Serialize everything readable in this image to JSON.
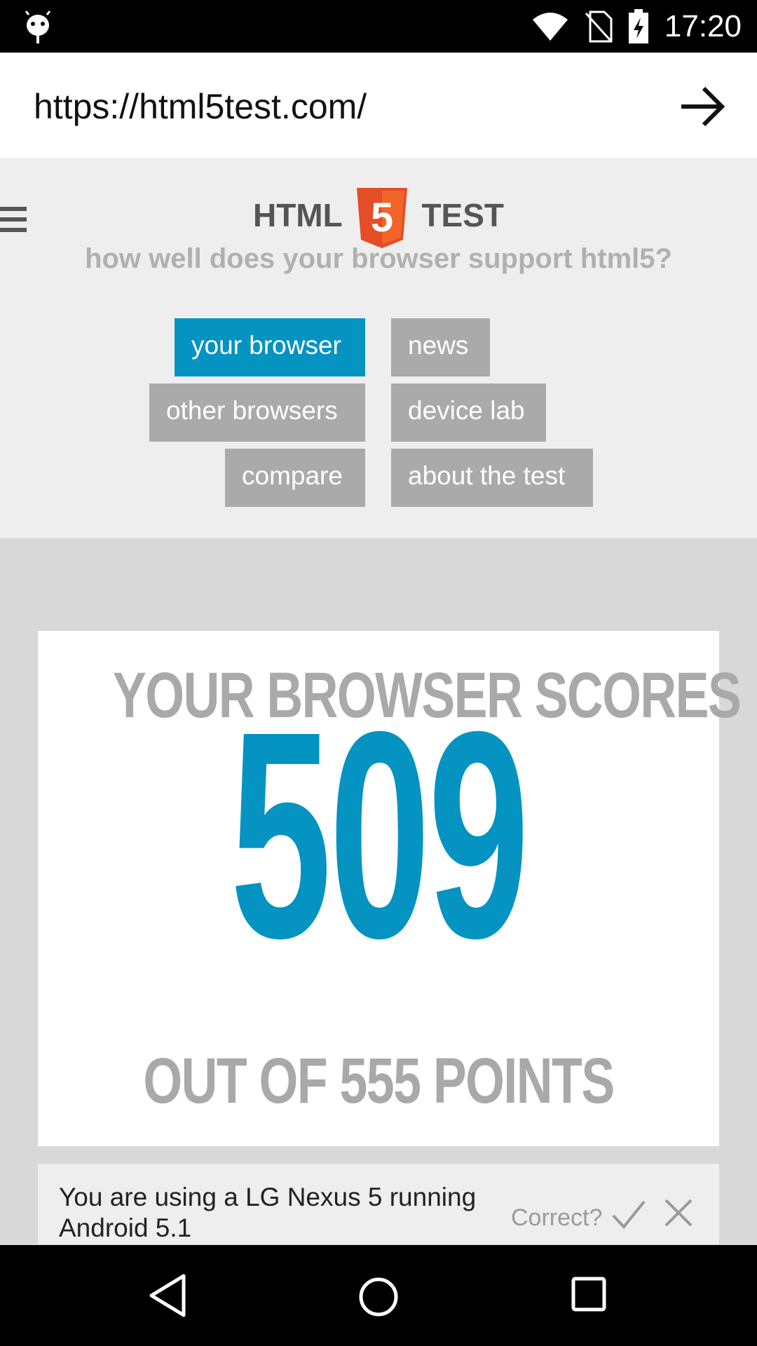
{
  "status_bar": {
    "time": "17:20",
    "icons": [
      "android-icon",
      "wifi-icon",
      "no-sim-icon",
      "battery-charging-icon"
    ]
  },
  "url_bar": {
    "value": "https://html5test.com/",
    "go_icon": "arrow-right-icon"
  },
  "header": {
    "menu_icon": "hamburger-menu-icon",
    "logo_left": "HTML",
    "logo_badge": "5",
    "logo_right": "TEST",
    "tagline": "how well does your browser support html5?",
    "brand_color": "#e44d26",
    "nav": [
      {
        "label": "your browser",
        "active": true
      },
      {
        "label": "news",
        "active": false
      },
      {
        "label": "other browsers",
        "active": false
      },
      {
        "label": "device lab",
        "active": false
      },
      {
        "label": "compare",
        "active": false
      },
      {
        "label": "about the test",
        "active": false
      }
    ],
    "active_color": "#0593c2",
    "inactive_color": "#aaaaaa"
  },
  "score": {
    "heading": "YOUR BROWSER SCORES",
    "value": "509",
    "footer": "OUT OF 555 POINTS",
    "accent_color": "#0593c2"
  },
  "device": {
    "text": "You are using a LG Nexus 5 running Android 5.1",
    "question": "Correct?",
    "confirm_icon": "checkmark-icon",
    "reject_icon": "close-icon"
  },
  "navigation_bar": {
    "icons": [
      "back-icon",
      "home-icon",
      "recent-apps-icon"
    ]
  }
}
